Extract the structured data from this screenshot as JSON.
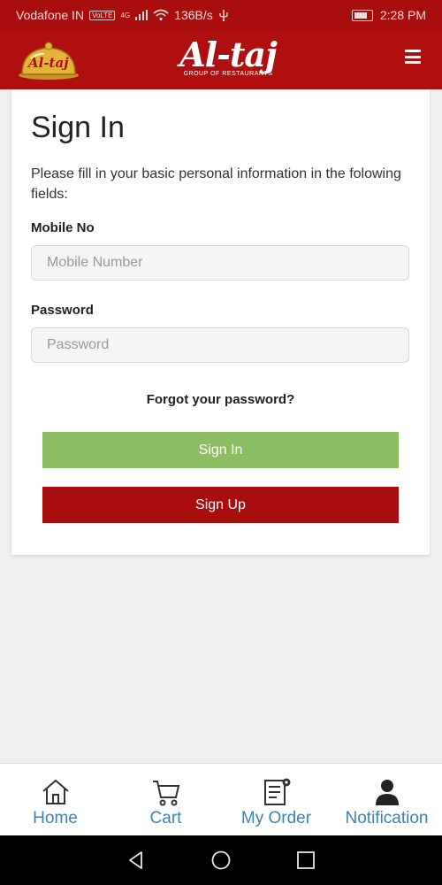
{
  "status_bar": {
    "carrier": "Vodafone IN",
    "volte": "VoLTE",
    "network": "4G",
    "speed": "136B/s",
    "time": "2:28 PM"
  },
  "header": {
    "badge_text": "Al-taj",
    "brand": "Al-taj",
    "brand_sub": "GROUP OF RESTAURANTS"
  },
  "form": {
    "title": "Sign In",
    "intro": "Please fill in your basic personal information in the folowing fields:",
    "mobile_label": "Mobile No",
    "mobile_placeholder": "Mobile Number",
    "password_label": "Password",
    "password_placeholder": "Password",
    "forgot": "Forgot your password?",
    "signin_label": "Sign In",
    "signup_label": "Sign Up"
  },
  "bottom_nav": {
    "items": [
      {
        "label": "Home",
        "icon": "home-icon"
      },
      {
        "label": "Cart",
        "icon": "cart-icon"
      },
      {
        "label": "My Order",
        "icon": "order-list-icon"
      },
      {
        "label": "Notification",
        "icon": "user-icon"
      }
    ]
  },
  "colors": {
    "brand_red": "#b00f0f",
    "signin_green": "#8cbd61",
    "nav_blue": "#3b82b8"
  }
}
